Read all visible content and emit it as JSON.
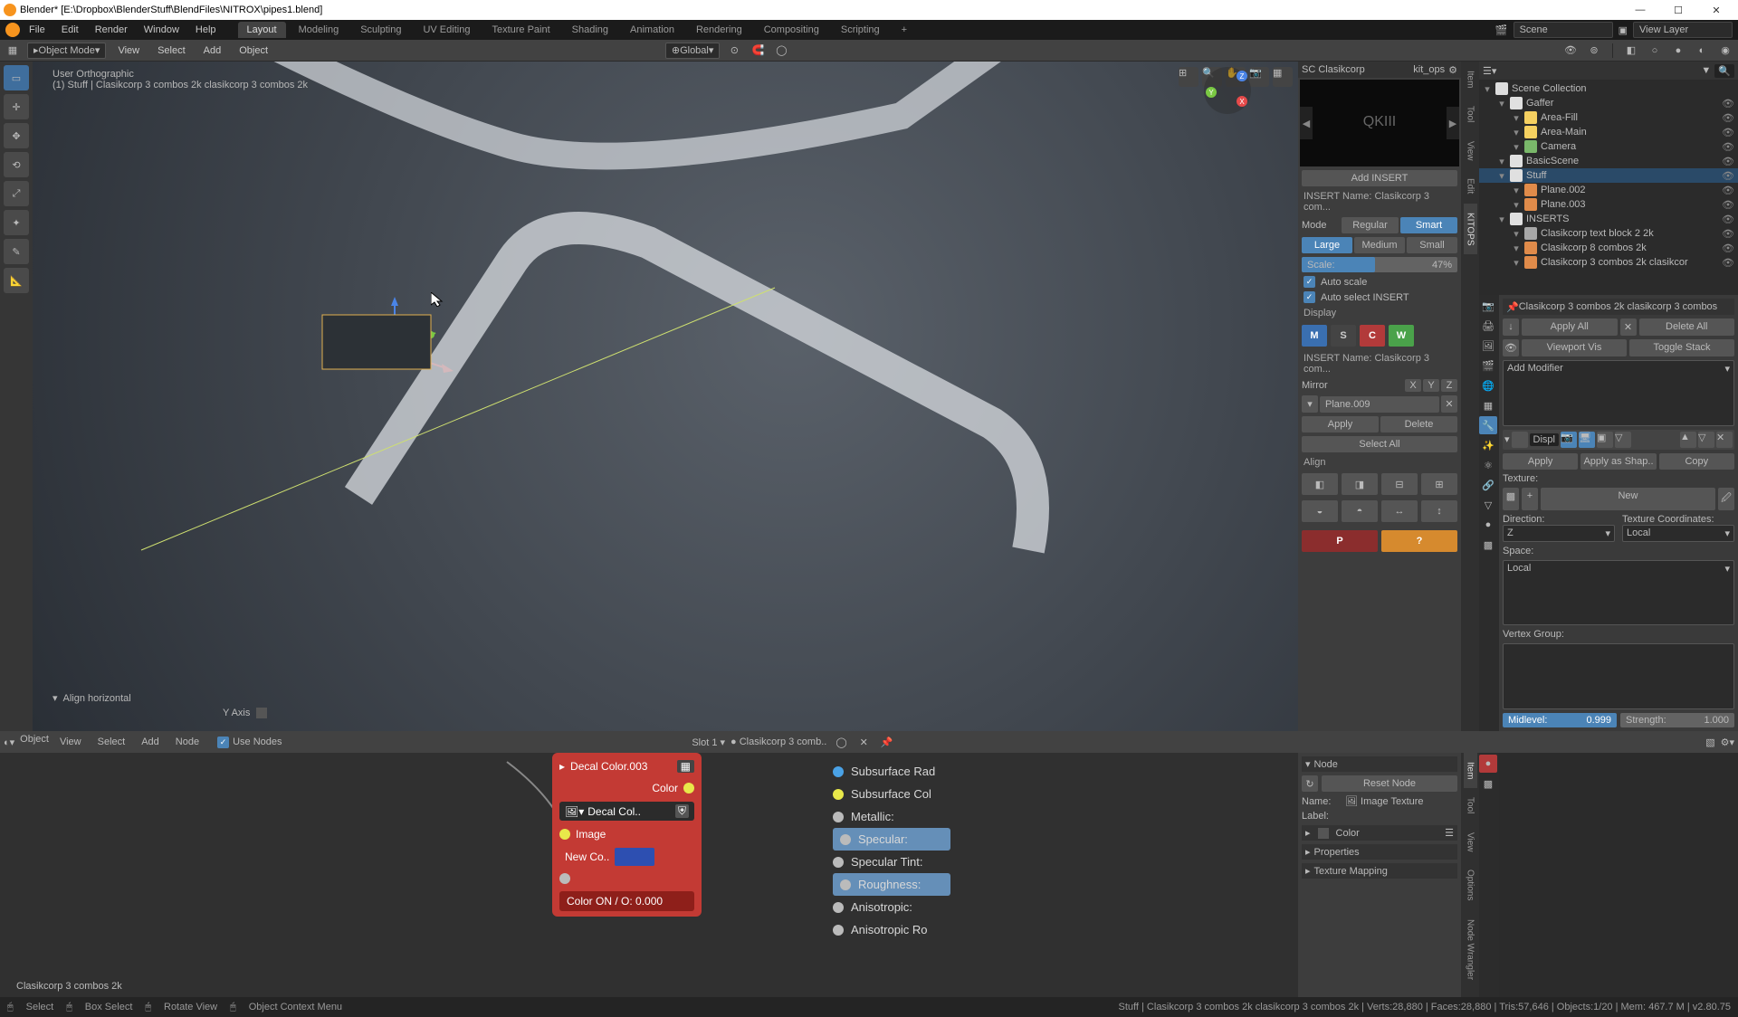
{
  "titlebar": {
    "title": "Blender* [E:\\Dropbox\\BlenderStuff\\BlendFiles\\NITROX\\pipes1.blend]"
  },
  "menubar": {
    "items": [
      "File",
      "Edit",
      "Render",
      "Window",
      "Help"
    ],
    "tabs": [
      "Layout",
      "Modeling",
      "Sculpting",
      "UV Editing",
      "Texture Paint",
      "Shading",
      "Animation",
      "Rendering",
      "Compositing",
      "Scripting"
    ],
    "active_tab": 0,
    "scene_label": "Scene",
    "viewlayer_label": "View Layer"
  },
  "viewport_header": {
    "mode": "Object Mode",
    "menus": [
      "View",
      "Select",
      "Add",
      "Object"
    ],
    "orientation": "Global"
  },
  "viewport_overlay": {
    "line1": "User Orthographic",
    "line2": "(1) Stuff | Clasikcorp   3 combos   2k clasikcorp   3 combos   2k",
    "bl": "Align horizontal",
    "bl2": "Y Axis"
  },
  "sidetabs_top": [
    "Item",
    "Tool",
    "View",
    "Edit",
    "KITOPS"
  ],
  "kitops": {
    "hdr_a": "SC Clasikcorp",
    "hdr_b": "kit_ops",
    "add_insert": "Add INSERT",
    "insert_name_l": "INSERT Name:",
    "insert_name_v": "Clasikcorp   3 com...",
    "mode_l": "Mode",
    "mode_opts": [
      "Regular",
      "Smart"
    ],
    "mode_sel": 1,
    "size_opts": [
      "Large",
      "Medium",
      "Small"
    ],
    "size_sel": 0,
    "scale_l": "Scale:",
    "scale_v": "47%",
    "auto_scale": "Auto scale",
    "auto_select": "Auto select INSERT",
    "display": "Display",
    "mswc": [
      "M",
      "S",
      "C",
      "W"
    ],
    "mswc_colors": [
      "#3a6fb0",
      "#444",
      "#b23a3a",
      "#4aa24a"
    ],
    "mirror_l": "Mirror",
    "mirror_axes": [
      "X",
      "Y",
      "Z"
    ],
    "plane": "Plane.009",
    "apply": "Apply",
    "delete": "Delete",
    "select_all": "Select All",
    "align": "Align"
  },
  "outliner": {
    "root": "Scene Collection",
    "items": [
      {
        "d": 1,
        "t": "col",
        "n": "Gaffer"
      },
      {
        "d": 2,
        "t": "light",
        "n": "Area-Fill"
      },
      {
        "d": 2,
        "t": "light",
        "n": "Area-Main"
      },
      {
        "d": 2,
        "t": "cam",
        "n": "Camera"
      },
      {
        "d": 1,
        "t": "col",
        "n": "BasicScene"
      },
      {
        "d": 1,
        "t": "col",
        "n": "Stuff",
        "sel": true
      },
      {
        "d": 2,
        "t": "mesh",
        "n": "Plane.002"
      },
      {
        "d": 2,
        "t": "mesh",
        "n": "Plane.003"
      },
      {
        "d": 1,
        "t": "col",
        "n": "INSERTS"
      },
      {
        "d": 2,
        "t": "empty",
        "n": "Clasikcorp   text block 2   2k"
      },
      {
        "d": 2,
        "t": "mesh",
        "n": "Clasikcorp   8 combos   2k"
      },
      {
        "d": 2,
        "t": "mesh",
        "n": "Clasikcorp   3 combos   2k clasikcor"
      }
    ]
  },
  "props": {
    "breadcrumb": "Clasikcorp   3 combos   2k clasikcorp   3 combos",
    "apply_all": "Apply All",
    "delete_all": "Delete All",
    "viewport_vis": "Viewport Vis",
    "toggle_stack": "Toggle Stack",
    "add_mod": "Add Modifier",
    "mod_name": "Displ",
    "apply": "Apply",
    "apply_shape": "Apply as Shap..",
    "copy": "Copy",
    "texture": "Texture:",
    "new": "New",
    "direction": "Direction:",
    "direction_v": "Z",
    "texcoords": "Texture Coordinates:",
    "texcoords_v": "Local",
    "space": "Space:",
    "space_v": "Local",
    "vgroup": "Vertex Group:",
    "midlevel": "Midlevel:",
    "midlevel_v": "0.999",
    "strength": "Strength:",
    "strength_v": "1.000"
  },
  "nodeheader": {
    "mode": "Object",
    "menus": [
      "View",
      "Select",
      "Add",
      "Node"
    ],
    "use_nodes": "Use Nodes",
    "slot": "Slot 1",
    "mat": "Clasikcorp   3 comb.."
  },
  "node_red": {
    "title": "Decal Color.003",
    "out_color": "Color",
    "image_field": "Decal Col..",
    "sock_image": "Image",
    "new_co": "New Co..",
    "numrow": "Color ON / O:  0.000"
  },
  "sock_list": [
    "Subsurface Rad",
    "Subsurface Col",
    "Metallic:",
    "Specular:",
    "Specular Tint:",
    "Roughness:",
    "Anisotropic:",
    "Anisotropic Ro"
  ],
  "sock_sel": 3,
  "nsidebar": {
    "tabs": [
      "Item",
      "Tool",
      "View",
      "Options",
      "Node Wrangler"
    ],
    "node_h": "Node",
    "reset": "Reset Node",
    "name_l": "Name:",
    "name_v": "Image Texture",
    "label_l": "Label:",
    "color": "Color",
    "props": "Properties",
    "texmap": "Texture Mapping"
  },
  "nodeinfo": "Clasikcorp   3 combos   2k",
  "status": {
    "select": "Select",
    "box": "Box Select",
    "rotate": "Rotate View",
    "ctx": "Object Context Menu",
    "stats": "Stuff | Clasikcorp   3 combos   2k clasikcorp   3 combos   2k | Verts:28,880 | Faces:28,880 | Tris:57,646 | Objects:1/20 | Mem: 467.7 M | v2.80.75"
  }
}
